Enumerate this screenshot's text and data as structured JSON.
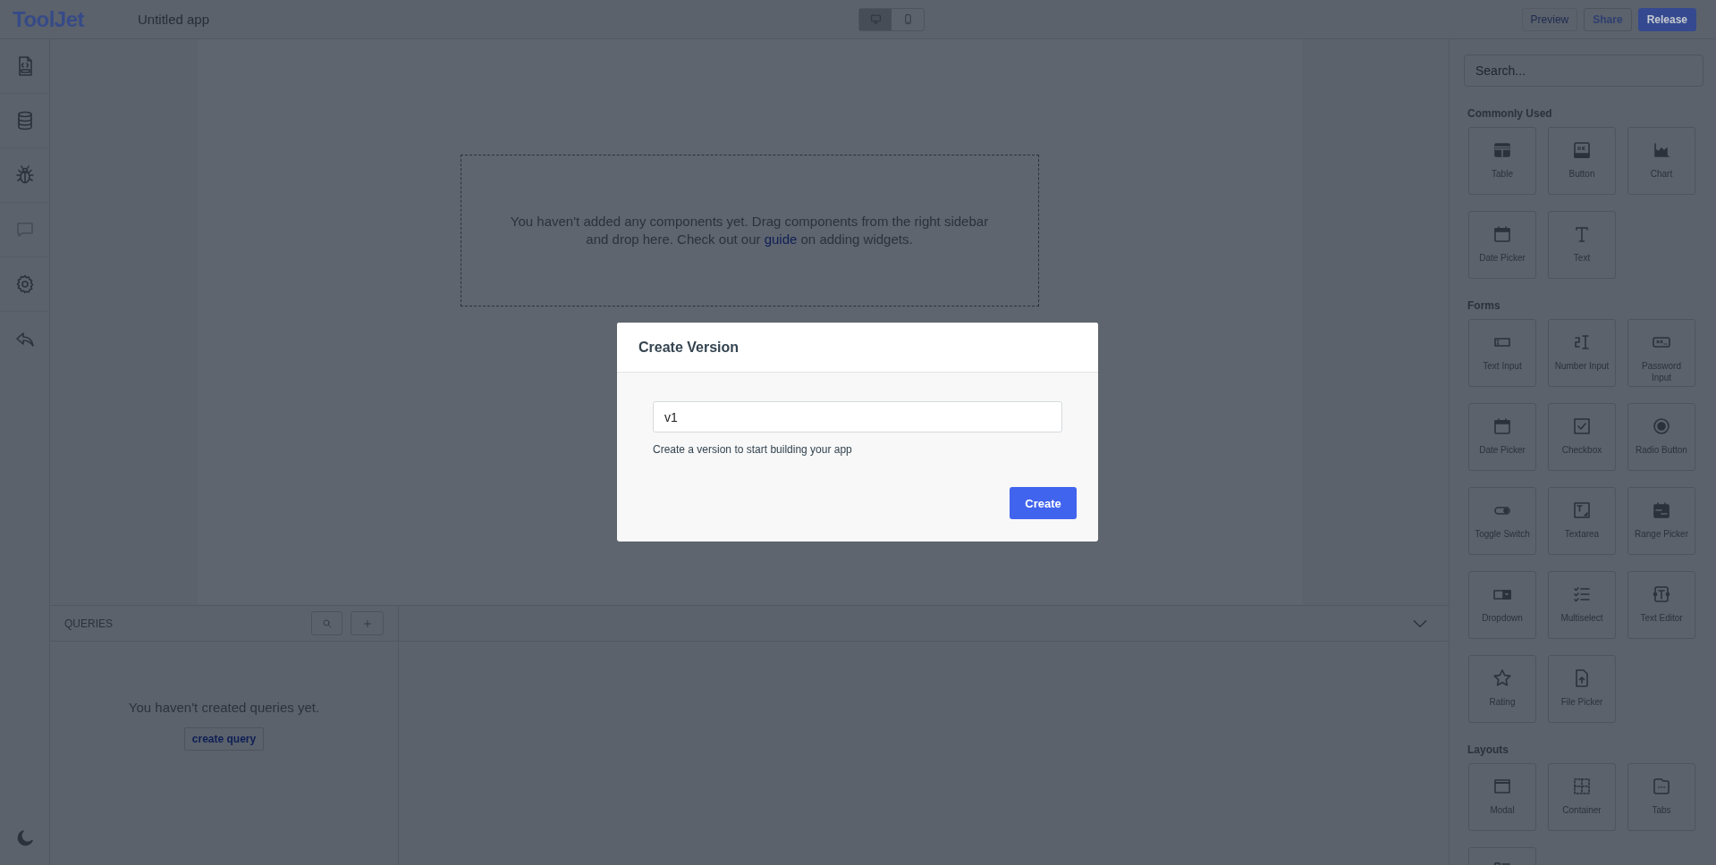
{
  "header": {
    "logo": "ToolJet",
    "app_name": "Untitled app",
    "view_modes": [
      {
        "kind": "desktop",
        "selected": true
      },
      {
        "kind": "mobile",
        "selected": false
      }
    ],
    "actions": [
      {
        "label": "Preview",
        "kind": "outline",
        "disabled": true
      },
      {
        "label": "Share",
        "kind": "outline",
        "disabled": false
      },
      {
        "label": "Release",
        "kind": "primary",
        "disabled": false
      }
    ]
  },
  "left_sidebar": {
    "items": [
      {
        "kind": "inspector",
        "disabled": false
      },
      {
        "kind": "sources",
        "disabled": false
      },
      {
        "kind": "debugger",
        "disabled": false
      },
      {
        "kind": "comments",
        "disabled": true
      },
      {
        "kind": "settings",
        "disabled": false
      },
      {
        "kind": "back",
        "disabled": false
      }
    ],
    "theme_toggle": {
      "kind": "moon"
    }
  },
  "canvas": {
    "empty_message": {
      "before": "You haven't added any components yet. Drag components from the right sidebar and drop here. Check out our ",
      "link": "guide",
      "after": " on adding widgets."
    }
  },
  "queries": {
    "title": "QUERIES",
    "empty_message": "You haven't created queries yet.",
    "create_button": "create query"
  },
  "widget_panel": {
    "search_placeholder": "Search...",
    "sections": [
      {
        "title": "Commonly Used",
        "items": [
          {
            "kind": "table",
            "label": "Table"
          },
          {
            "kind": "button",
            "label": "Button"
          },
          {
            "kind": "chart",
            "label": "Chart"
          },
          {
            "kind": "date",
            "label": "Date Picker"
          },
          {
            "kind": "text",
            "label": "Text"
          }
        ]
      },
      {
        "title": "Forms",
        "items": [
          {
            "kind": "textinput",
            "label": "Text Input"
          },
          {
            "kind": "number",
            "label": "Number Input"
          },
          {
            "kind": "password",
            "label": "Password Input"
          },
          {
            "kind": "date",
            "label": "Date Picker"
          },
          {
            "kind": "checkbox",
            "label": "Checkbox"
          },
          {
            "kind": "radio",
            "label": "Radio Button"
          },
          {
            "kind": "toggle",
            "label": "Toggle Switch"
          },
          {
            "kind": "textarea",
            "label": "Textarea"
          },
          {
            "kind": "range",
            "label": "Range Picker"
          },
          {
            "kind": "dropdown",
            "label": "Dropdown"
          },
          {
            "kind": "multiselect",
            "label": "Multiselect"
          },
          {
            "kind": "editor",
            "label": "Text Editor"
          },
          {
            "kind": "rating",
            "label": "Rating"
          },
          {
            "kind": "file",
            "label": "File Picker"
          }
        ]
      },
      {
        "title": "Layouts",
        "items": [
          {
            "kind": "modal",
            "label": "Modal"
          },
          {
            "kind": "container",
            "label": "Container"
          },
          {
            "kind": "tabs",
            "label": "Tabs"
          },
          {
            "kind": "list"
          }
        ]
      }
    ]
  },
  "modal": {
    "title": "Create Version",
    "input_value": "v1",
    "help": "Create a version to start building your app",
    "submit": "Create"
  }
}
